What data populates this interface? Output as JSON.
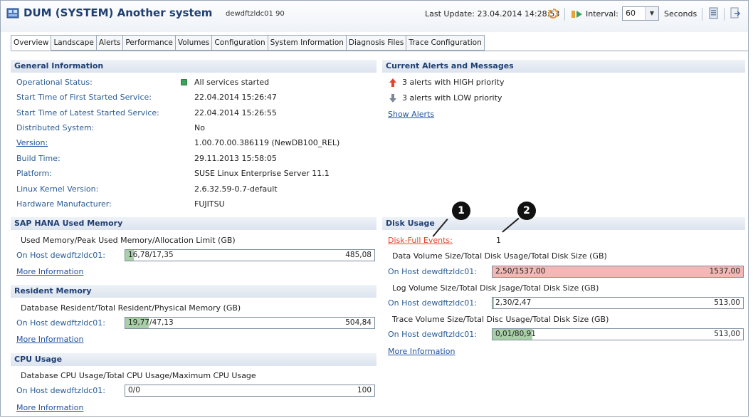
{
  "header": {
    "title": "DUM (SYSTEM) Another system",
    "host": "dewdftzldc01 90",
    "last_update": "Last Update: 23.04.2014 14:28:53",
    "interval_label": "Interval:",
    "interval_value": "60",
    "seconds_label": "Seconds"
  },
  "tabs": [
    {
      "label": "Overview",
      "active": true
    },
    {
      "label": "Landscape"
    },
    {
      "label": "Alerts"
    },
    {
      "label": "Performance"
    },
    {
      "label": "Volumes"
    },
    {
      "label": "Configuration"
    },
    {
      "label": "System Information"
    },
    {
      "label": "Diagnosis Files"
    },
    {
      "label": "Trace Configuration"
    }
  ],
  "general": {
    "title": "General Information",
    "rows": [
      {
        "label": "Operational Status:",
        "value": "All services started"
      },
      {
        "label": "Start Time of First Started Service:",
        "value": "22.04.2014 15:26:47"
      },
      {
        "label": "Start Time of Latest Started Service:",
        "value": "22.04.2014 15:26:55"
      },
      {
        "label": "Distributed System:",
        "value": "No"
      },
      {
        "label": "Version:",
        "value": "1.00.70.00.386119 (NewDB100_REL)"
      },
      {
        "label": "Build Time:",
        "value": "29.11.2013 15:58:05"
      },
      {
        "label": "Platform:",
        "value": "SUSE Linux Enterprise Server 11.1"
      },
      {
        "label": "Linux Kernel Version:",
        "value": "2.6.32.59-0.7-default"
      },
      {
        "label": "Hardware Manufacturer:",
        "value": "FUJITSU"
      }
    ]
  },
  "alerts": {
    "title": "Current Alerts and Messages",
    "high": "3 alerts with HIGH priority",
    "low": "3 alerts with LOW priority",
    "show_link": "Show Alerts"
  },
  "memory": {
    "title": "SAP HANA Used Memory",
    "caption": "Used Memory/Peak Used Memory/Allocation Limit (GB)",
    "host_label": "On Host dewdftzldc01:",
    "bar_text": "16,78/17,35",
    "limit": "485,08",
    "fill_fraction": 0.035,
    "more": "More Information"
  },
  "resident": {
    "title": "Resident Memory",
    "caption": "Database Resident/Total Resident/Physical Memory (GB)",
    "host_label": "On Host dewdftzldc01:",
    "bar_text": "19,77/47,13",
    "limit": "504,84",
    "fill_fraction": 0.094,
    "more": "More Information"
  },
  "cpu": {
    "title": "CPU Usage",
    "caption": "Database CPU Usage/Total CPU Usage/Maximum CPU Usage",
    "host_label": "On Host dewdftzldc01:",
    "bar_text": "0/0",
    "limit": "100",
    "fill_fraction": 0,
    "more": "More Information"
  },
  "disk": {
    "title": "Disk Usage",
    "full_events_label": "Disk-Full Events:",
    "full_events_value": "1",
    "data_caption": "Data Volume Size/Total Disk Usage/Total Disk Size (GB)",
    "data_host": "On Host dewdftzldc01:",
    "data_bar": "2,50/1537,00",
    "data_limit": "1537,00",
    "data_fill": 1.0,
    "log_caption": "Log Volume Size/Total Disk Jsage/Total Disk Size (GB)",
    "log_host": "On Host dewdftzldc01:",
    "log_bar": "2,30/2,47",
    "log_limit": "513,00",
    "log_fill": 0.005,
    "trace_caption": "Trace Volume Size/Total Disc Usage/Total Disk Size (GB)",
    "trace_host": "On Host dewdftzldc01:",
    "trace_bar": "0,01/80,91",
    "trace_limit": "513,00",
    "trace_fill": 0.158,
    "more": "More Information"
  },
  "callouts": [
    "1",
    "2"
  ],
  "colors": {
    "fill_green": "#a9cfa6",
    "fill_red": "#f3b8b6",
    "link": "#2052a3",
    "heading": "#1f3f73"
  }
}
